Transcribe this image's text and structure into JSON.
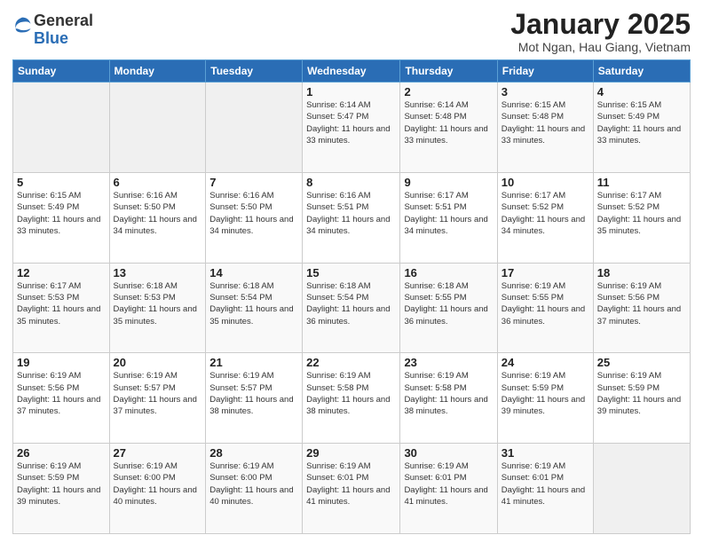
{
  "logo": {
    "general": "General",
    "blue": "Blue"
  },
  "header": {
    "title": "January 2025",
    "subtitle": "Mot Ngan, Hau Giang, Vietnam"
  },
  "weekdays": [
    "Sunday",
    "Monday",
    "Tuesday",
    "Wednesday",
    "Thursday",
    "Friday",
    "Saturday"
  ],
  "weeks": [
    [
      {
        "day": "",
        "info": ""
      },
      {
        "day": "",
        "info": ""
      },
      {
        "day": "",
        "info": ""
      },
      {
        "day": "1",
        "info": "Sunrise: 6:14 AM\nSunset: 5:47 PM\nDaylight: 11 hours\nand 33 minutes."
      },
      {
        "day": "2",
        "info": "Sunrise: 6:14 AM\nSunset: 5:48 PM\nDaylight: 11 hours\nand 33 minutes."
      },
      {
        "day": "3",
        "info": "Sunrise: 6:15 AM\nSunset: 5:48 PM\nDaylight: 11 hours\nand 33 minutes."
      },
      {
        "day": "4",
        "info": "Sunrise: 6:15 AM\nSunset: 5:49 PM\nDaylight: 11 hours\nand 33 minutes."
      }
    ],
    [
      {
        "day": "5",
        "info": "Sunrise: 6:15 AM\nSunset: 5:49 PM\nDaylight: 11 hours\nand 33 minutes."
      },
      {
        "day": "6",
        "info": "Sunrise: 6:16 AM\nSunset: 5:50 PM\nDaylight: 11 hours\nand 34 minutes."
      },
      {
        "day": "7",
        "info": "Sunrise: 6:16 AM\nSunset: 5:50 PM\nDaylight: 11 hours\nand 34 minutes."
      },
      {
        "day": "8",
        "info": "Sunrise: 6:16 AM\nSunset: 5:51 PM\nDaylight: 11 hours\nand 34 minutes."
      },
      {
        "day": "9",
        "info": "Sunrise: 6:17 AM\nSunset: 5:51 PM\nDaylight: 11 hours\nand 34 minutes."
      },
      {
        "day": "10",
        "info": "Sunrise: 6:17 AM\nSunset: 5:52 PM\nDaylight: 11 hours\nand 34 minutes."
      },
      {
        "day": "11",
        "info": "Sunrise: 6:17 AM\nSunset: 5:52 PM\nDaylight: 11 hours\nand 35 minutes."
      }
    ],
    [
      {
        "day": "12",
        "info": "Sunrise: 6:17 AM\nSunset: 5:53 PM\nDaylight: 11 hours\nand 35 minutes."
      },
      {
        "day": "13",
        "info": "Sunrise: 6:18 AM\nSunset: 5:53 PM\nDaylight: 11 hours\nand 35 minutes."
      },
      {
        "day": "14",
        "info": "Sunrise: 6:18 AM\nSunset: 5:54 PM\nDaylight: 11 hours\nand 35 minutes."
      },
      {
        "day": "15",
        "info": "Sunrise: 6:18 AM\nSunset: 5:54 PM\nDaylight: 11 hours\nand 36 minutes."
      },
      {
        "day": "16",
        "info": "Sunrise: 6:18 AM\nSunset: 5:55 PM\nDaylight: 11 hours\nand 36 minutes."
      },
      {
        "day": "17",
        "info": "Sunrise: 6:19 AM\nSunset: 5:55 PM\nDaylight: 11 hours\nand 36 minutes."
      },
      {
        "day": "18",
        "info": "Sunrise: 6:19 AM\nSunset: 5:56 PM\nDaylight: 11 hours\nand 37 minutes."
      }
    ],
    [
      {
        "day": "19",
        "info": "Sunrise: 6:19 AM\nSunset: 5:56 PM\nDaylight: 11 hours\nand 37 minutes."
      },
      {
        "day": "20",
        "info": "Sunrise: 6:19 AM\nSunset: 5:57 PM\nDaylight: 11 hours\nand 37 minutes."
      },
      {
        "day": "21",
        "info": "Sunrise: 6:19 AM\nSunset: 5:57 PM\nDaylight: 11 hours\nand 38 minutes."
      },
      {
        "day": "22",
        "info": "Sunrise: 6:19 AM\nSunset: 5:58 PM\nDaylight: 11 hours\nand 38 minutes."
      },
      {
        "day": "23",
        "info": "Sunrise: 6:19 AM\nSunset: 5:58 PM\nDaylight: 11 hours\nand 38 minutes."
      },
      {
        "day": "24",
        "info": "Sunrise: 6:19 AM\nSunset: 5:59 PM\nDaylight: 11 hours\nand 39 minutes."
      },
      {
        "day": "25",
        "info": "Sunrise: 6:19 AM\nSunset: 5:59 PM\nDaylight: 11 hours\nand 39 minutes."
      }
    ],
    [
      {
        "day": "26",
        "info": "Sunrise: 6:19 AM\nSunset: 5:59 PM\nDaylight: 11 hours\nand 39 minutes."
      },
      {
        "day": "27",
        "info": "Sunrise: 6:19 AM\nSunset: 6:00 PM\nDaylight: 11 hours\nand 40 minutes."
      },
      {
        "day": "28",
        "info": "Sunrise: 6:19 AM\nSunset: 6:00 PM\nDaylight: 11 hours\nand 40 minutes."
      },
      {
        "day": "29",
        "info": "Sunrise: 6:19 AM\nSunset: 6:01 PM\nDaylight: 11 hours\nand 41 minutes."
      },
      {
        "day": "30",
        "info": "Sunrise: 6:19 AM\nSunset: 6:01 PM\nDaylight: 11 hours\nand 41 minutes."
      },
      {
        "day": "31",
        "info": "Sunrise: 6:19 AM\nSunset: 6:01 PM\nDaylight: 11 hours\nand 41 minutes."
      },
      {
        "day": "",
        "info": ""
      }
    ]
  ]
}
